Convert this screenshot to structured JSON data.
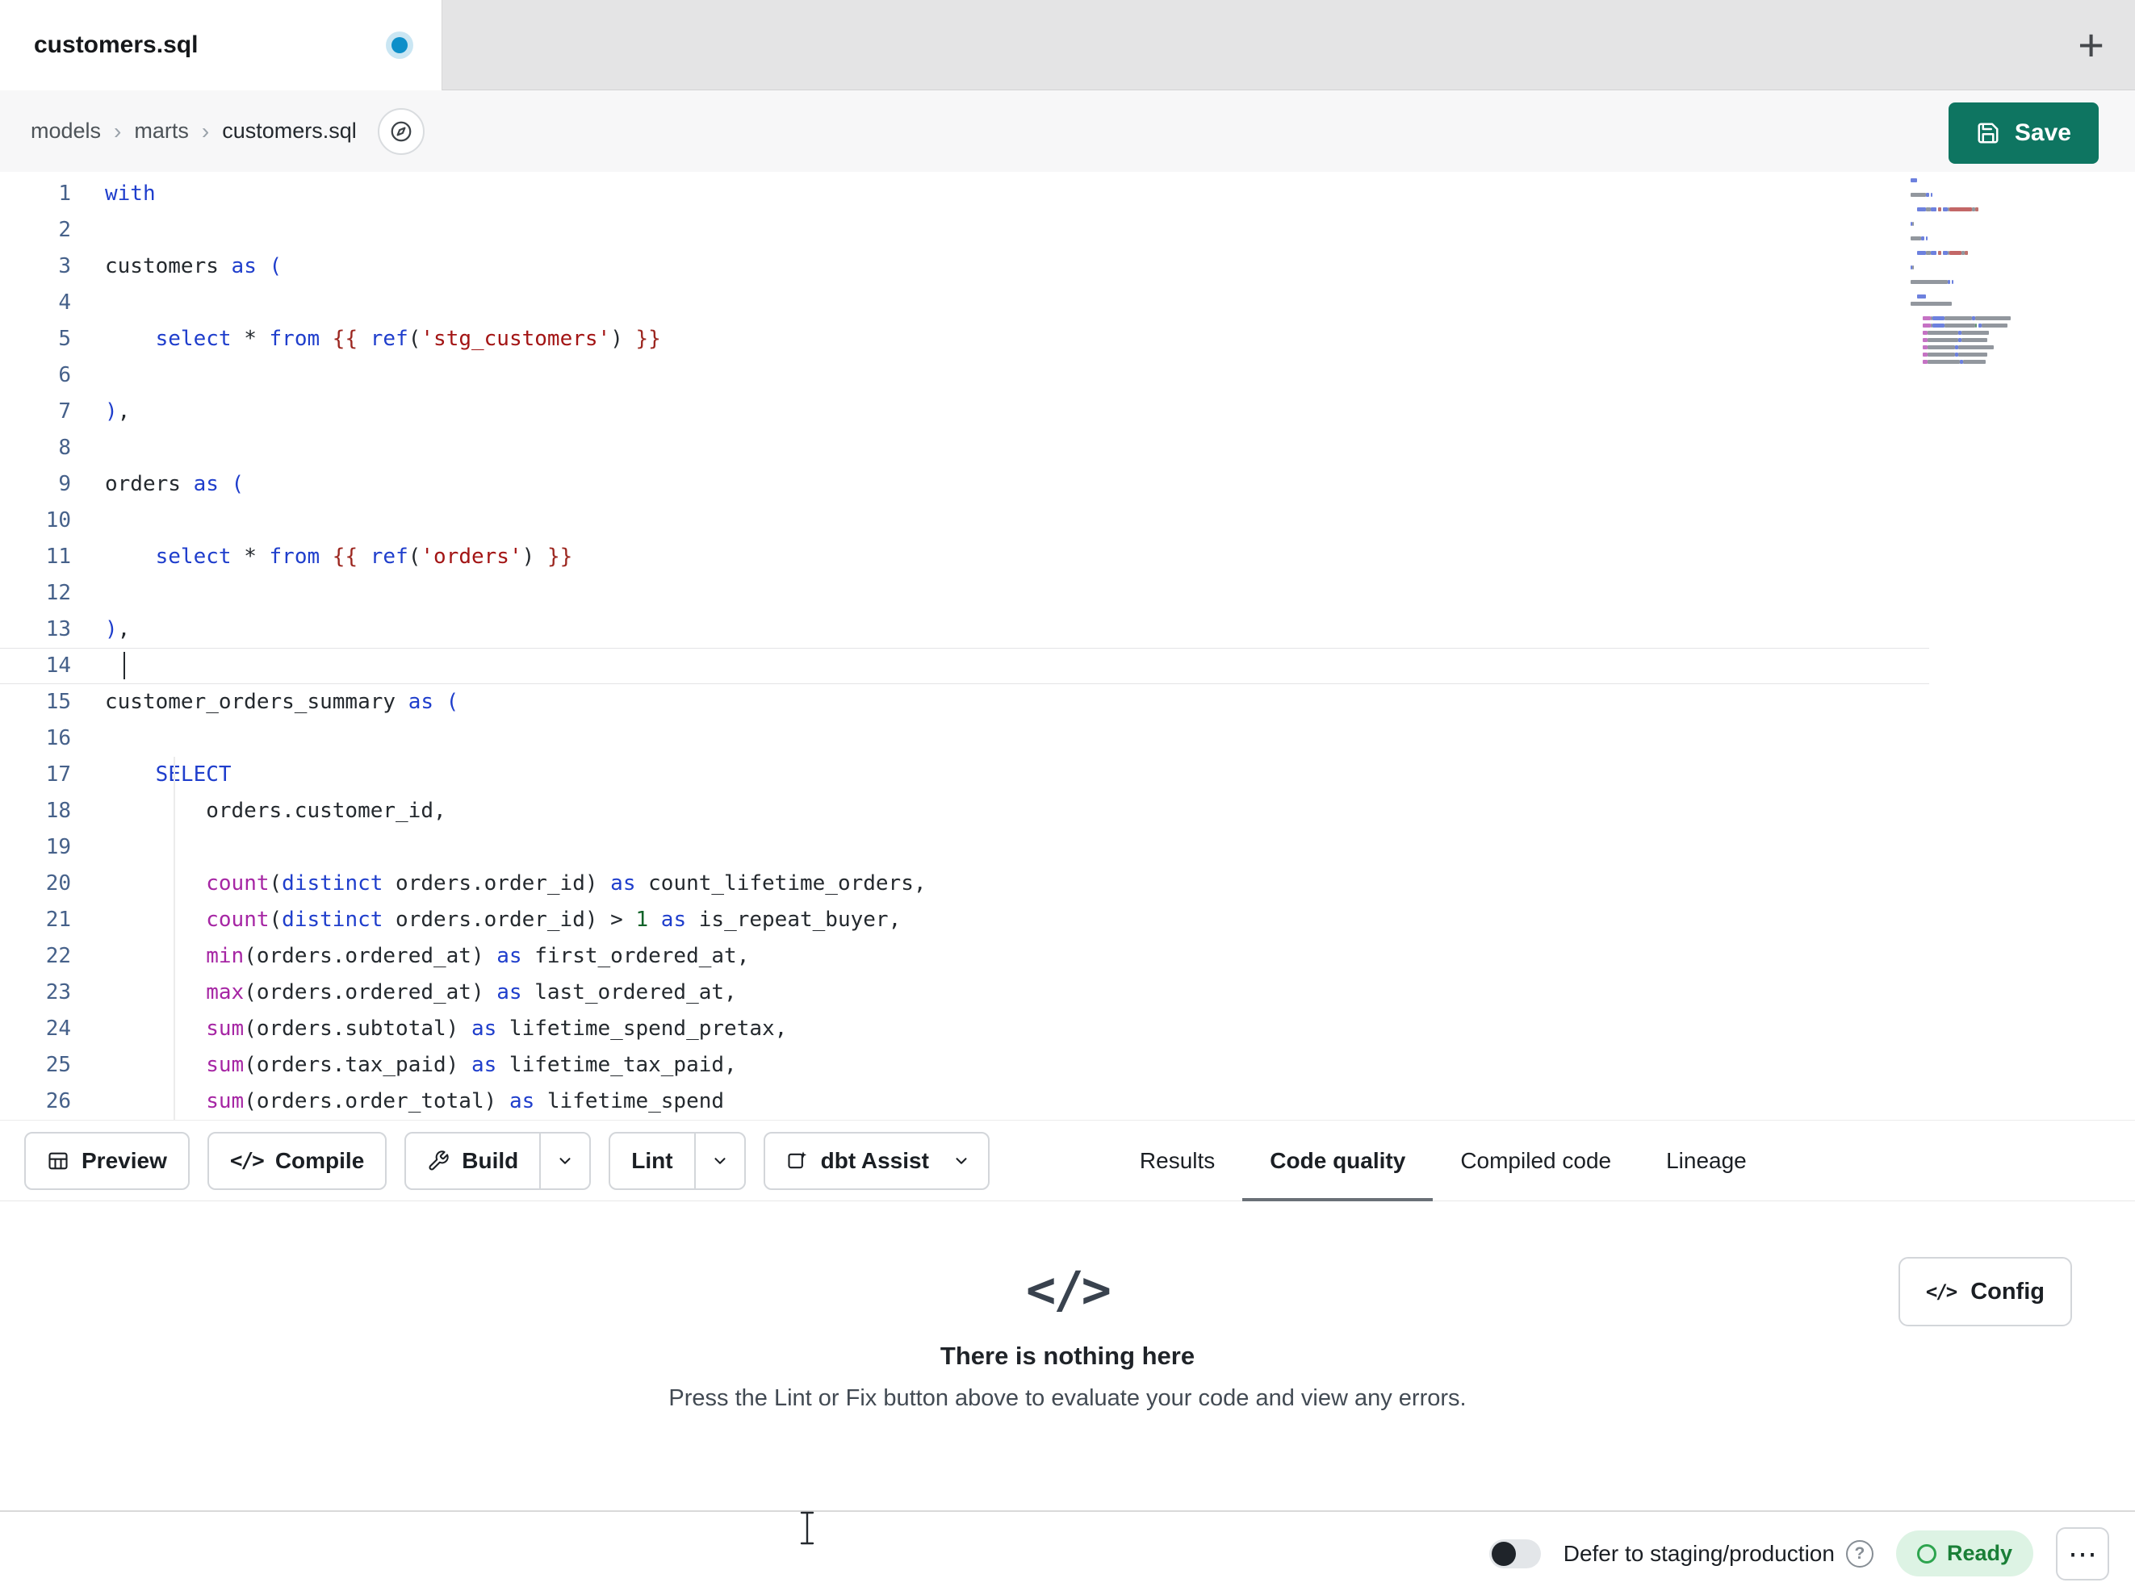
{
  "colors": {
    "save_button": "#0e7561",
    "keyword": "#1f3ecc",
    "function": "#a626a4",
    "string": "#a31515",
    "jinja": "#9c2720",
    "number": "#116329",
    "plain": "#24292e",
    "paren": "#1f3ecc",
    "line_number": "#46618a",
    "tab_dot": "#0d8fc9",
    "ready_bg": "#ddf3e4",
    "ready_text": "#1a7f37",
    "ready_ring": "#2da44e"
  },
  "tab_bar": {
    "active_tab": "customers.sql",
    "new_tab_icon": "+"
  },
  "breadcrumb": {
    "items": [
      "models",
      "marts",
      "customers.sql"
    ],
    "separator": "›"
  },
  "save_button": {
    "label": "Save"
  },
  "editor": {
    "active_line": 14,
    "lines": [
      {
        "num": 1,
        "segs": [
          [
            "kw",
            "with"
          ]
        ]
      },
      {
        "num": 2,
        "segs": []
      },
      {
        "num": 3,
        "segs": [
          [
            "pl",
            "customers "
          ],
          [
            "kw",
            "as"
          ],
          [
            "pl",
            " "
          ],
          [
            "pb",
            "("
          ]
        ]
      },
      {
        "num": 4,
        "segs": []
      },
      {
        "num": 5,
        "segs": [
          [
            "pl",
            "    "
          ],
          [
            "kw",
            "select"
          ],
          [
            "pl",
            " * "
          ],
          [
            "kw",
            "from"
          ],
          [
            "pl",
            " "
          ],
          [
            "jj",
            "{{"
          ],
          [
            "pl",
            " "
          ],
          [
            "kw",
            "ref"
          ],
          [
            "pl",
            "("
          ],
          [
            "str",
            "'stg_customers'"
          ],
          [
            "pl",
            ") "
          ],
          [
            "jj",
            "}}"
          ]
        ]
      },
      {
        "num": 6,
        "segs": []
      },
      {
        "num": 7,
        "segs": [
          [
            "pb",
            ")"
          ],
          [
            "pl",
            ","
          ]
        ]
      },
      {
        "num": 8,
        "segs": []
      },
      {
        "num": 9,
        "segs": [
          [
            "pl",
            "orders "
          ],
          [
            "kw",
            "as"
          ],
          [
            "pl",
            " "
          ],
          [
            "pb",
            "("
          ]
        ]
      },
      {
        "num": 10,
        "segs": []
      },
      {
        "num": 11,
        "segs": [
          [
            "pl",
            "    "
          ],
          [
            "kw",
            "select"
          ],
          [
            "pl",
            " * "
          ],
          [
            "kw",
            "from"
          ],
          [
            "pl",
            " "
          ],
          [
            "jj",
            "{{"
          ],
          [
            "pl",
            " "
          ],
          [
            "kw",
            "ref"
          ],
          [
            "pl",
            "("
          ],
          [
            "str",
            "'orders'"
          ],
          [
            "pl",
            ") "
          ],
          [
            "jj",
            "}}"
          ]
        ]
      },
      {
        "num": 12,
        "segs": []
      },
      {
        "num": 13,
        "segs": [
          [
            "pb",
            ")"
          ],
          [
            "pl",
            ","
          ]
        ]
      },
      {
        "num": 14,
        "segs": []
      },
      {
        "num": 15,
        "segs": [
          [
            "pl",
            "customer_orders_summary "
          ],
          [
            "kw",
            "as"
          ],
          [
            "pl",
            " "
          ],
          [
            "pb",
            "("
          ]
        ]
      },
      {
        "num": 16,
        "segs": []
      },
      {
        "num": 17,
        "segs": [
          [
            "pl",
            "    "
          ],
          [
            "kw",
            "SELECT"
          ]
        ]
      },
      {
        "num": 18,
        "segs": [
          [
            "pl",
            "        orders.customer_id,"
          ]
        ]
      },
      {
        "num": 19,
        "segs": []
      },
      {
        "num": 20,
        "segs": [
          [
            "pl",
            "        "
          ],
          [
            "fn",
            "count"
          ],
          [
            "pl",
            "("
          ],
          [
            "kw",
            "distinct"
          ],
          [
            "pl",
            " orders.order_id) "
          ],
          [
            "kw",
            "as"
          ],
          [
            "pl",
            " count_lifetime_orders,"
          ]
        ]
      },
      {
        "num": 21,
        "segs": [
          [
            "pl",
            "        "
          ],
          [
            "fn",
            "count"
          ],
          [
            "pl",
            "("
          ],
          [
            "kw",
            "distinct"
          ],
          [
            "pl",
            " orders.order_id) > "
          ],
          [
            "num",
            "1"
          ],
          [
            "pl",
            " "
          ],
          [
            "kw",
            "as"
          ],
          [
            "pl",
            " is_repeat_buyer,"
          ]
        ]
      },
      {
        "num": 22,
        "segs": [
          [
            "pl",
            "        "
          ],
          [
            "fn",
            "min"
          ],
          [
            "pl",
            "(orders.ordered_at) "
          ],
          [
            "kw",
            "as"
          ],
          [
            "pl",
            " first_ordered_at,"
          ]
        ]
      },
      {
        "num": 23,
        "segs": [
          [
            "pl",
            "        "
          ],
          [
            "fn",
            "max"
          ],
          [
            "pl",
            "(orders.ordered_at) "
          ],
          [
            "kw",
            "as"
          ],
          [
            "pl",
            " last_ordered_at,"
          ]
        ]
      },
      {
        "num": 24,
        "segs": [
          [
            "pl",
            "        "
          ],
          [
            "fn",
            "sum"
          ],
          [
            "pl",
            "(orders.subtotal) "
          ],
          [
            "kw",
            "as"
          ],
          [
            "pl",
            " lifetime_spend_pretax,"
          ]
        ]
      },
      {
        "num": 25,
        "segs": [
          [
            "pl",
            "        "
          ],
          [
            "fn",
            "sum"
          ],
          [
            "pl",
            "(orders.tax_paid) "
          ],
          [
            "kw",
            "as"
          ],
          [
            "pl",
            " lifetime_tax_paid,"
          ]
        ]
      },
      {
        "num": 26,
        "segs": [
          [
            "pl",
            "        "
          ],
          [
            "fn",
            "sum"
          ],
          [
            "pl",
            "(orders.order_total) "
          ],
          [
            "kw",
            "as"
          ],
          [
            "pl",
            " lifetime_spend"
          ]
        ]
      }
    ]
  },
  "toolbar": {
    "preview": "Preview",
    "compile": "Compile",
    "compile_icon": "</>",
    "build": "Build",
    "lint": "Lint",
    "assist": "dbt Assist",
    "tabs": [
      {
        "label": "Results",
        "active": false
      },
      {
        "label": "Code quality",
        "active": true
      },
      {
        "label": "Compiled code",
        "active": false
      },
      {
        "label": "Lineage",
        "active": false
      }
    ]
  },
  "empty_state": {
    "icon": "</>",
    "title": "There is nothing here",
    "subtitle": "Press the Lint or Fix button above to evaluate your code and view any errors.",
    "config_icon": "</>",
    "config_label": "Config"
  },
  "status_bar": {
    "defer_label": "Defer to staging/production",
    "help_icon": "?",
    "ready_label": "Ready",
    "more_menu_icon": "⋯"
  }
}
